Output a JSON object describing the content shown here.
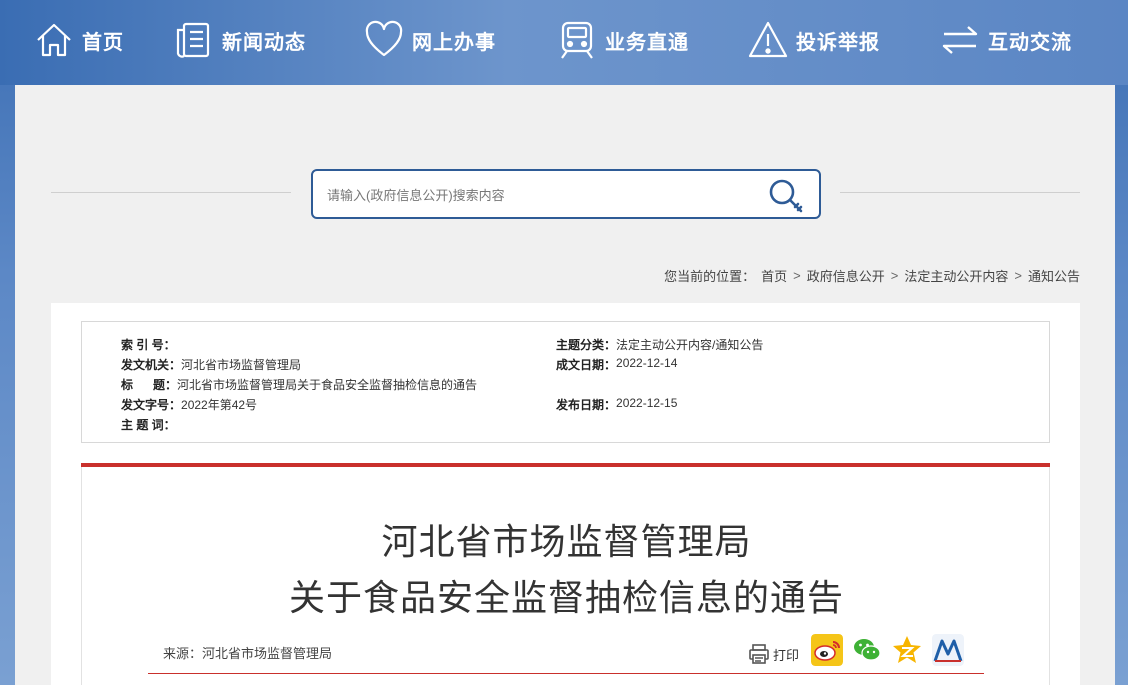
{
  "nav": {
    "items": [
      {
        "label": "首页",
        "icon": "home-icon"
      },
      {
        "label": "新闻动态",
        "icon": "news-icon"
      },
      {
        "label": "网上办事",
        "icon": "heart-icon"
      },
      {
        "label": "业务直通",
        "icon": "train-icon"
      },
      {
        "label": "投诉举报",
        "icon": "warning-icon"
      },
      {
        "label": "互动交流",
        "icon": "exchange-icon"
      }
    ]
  },
  "search": {
    "placeholder": "请输入(政府信息公开)搜索内容",
    "value": ""
  },
  "breadcrumb": {
    "prefix": "您当前的位置：",
    "items": [
      "首页",
      "政府信息公开",
      "法定主动公开内容",
      "通知公告"
    ],
    "separator": ">"
  },
  "meta": {
    "index_no": {
      "key": "索 引 号：",
      "value": ""
    },
    "issuer": {
      "key": "发文机关：",
      "value": "河北省市场监督管理局"
    },
    "title": {
      "key": "标      题：",
      "value": "河北省市场监督管理局关于食品安全监督抽检信息的通告"
    },
    "doc_no": {
      "key": "发文字号：",
      "value": "2022年第42号"
    },
    "keywords": {
      "key": "主 题 词：",
      "value": ""
    },
    "category": {
      "key": "主题分类：",
      "value": "法定主动公开内容/通知公告"
    },
    "created": {
      "key": "成文日期：",
      "value": "2022-12-14"
    },
    "published": {
      "key": "发布日期：",
      "value": "2022-12-15"
    }
  },
  "article": {
    "title_line1": "河北省市场监督管理局",
    "title_line2": "关于食品安全监督抽检信息的通告",
    "source": "来源：河北省市场监督管理局",
    "print_label": "打印"
  },
  "colors": {
    "accent_red": "#c9302c",
    "nav_blue": "#3a6db3",
    "search_border": "#2e5b96"
  }
}
